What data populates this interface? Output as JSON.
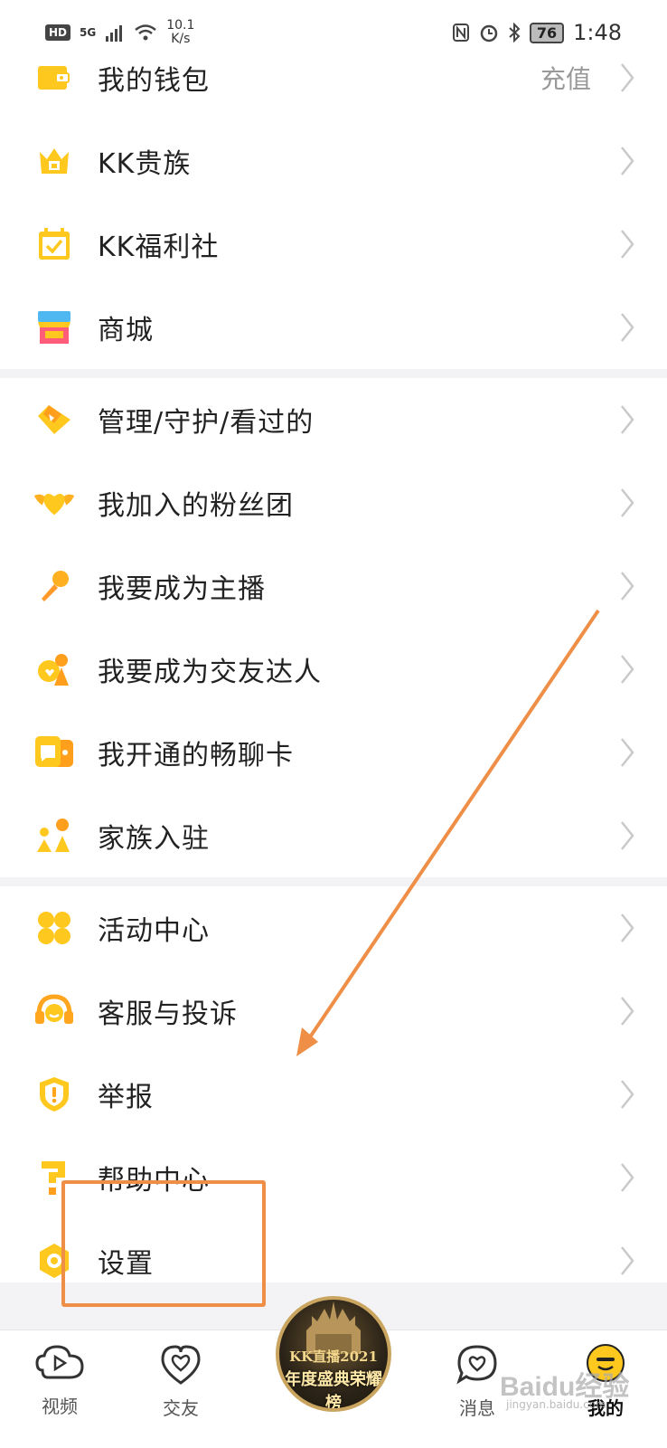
{
  "status_bar": {
    "left_badge": "HD",
    "signal": "5G",
    "net_speed_value": "10.1",
    "net_speed_unit": "K/s",
    "battery": "76",
    "time": "1:48"
  },
  "menu": {
    "group1": [
      {
        "label": "我的钱包",
        "aside": "充值",
        "icon": "wallet-icon"
      },
      {
        "label": "KK贵族",
        "icon": "crown-icon"
      },
      {
        "label": "KK福利社",
        "icon": "calendar-check-icon"
      },
      {
        "label": "商城",
        "icon": "shop-icon"
      }
    ],
    "group2": [
      {
        "label": "管理/守护/看过的",
        "icon": "diamond-icon"
      },
      {
        "label": "我加入的粉丝团",
        "icon": "winged-heart-icon"
      },
      {
        "label": "我要成为主播",
        "icon": "microphone-icon"
      },
      {
        "label": "我要成为交友达人",
        "icon": "dating-icon"
      },
      {
        "label": "我开通的畅聊卡",
        "icon": "chat-card-icon"
      },
      {
        "label": "家族入驻",
        "icon": "family-icon"
      }
    ],
    "group3": [
      {
        "label": "活动中心",
        "icon": "activity-icon"
      },
      {
        "label": "客服与投诉",
        "icon": "headset-icon"
      },
      {
        "label": "举报",
        "icon": "report-shield-icon"
      },
      {
        "label": "帮助中心",
        "icon": "question-icon"
      },
      {
        "label": "设置",
        "icon": "settings-icon"
      }
    ]
  },
  "bottom_nav": {
    "video": "视频",
    "friends": "交友",
    "badge_top": "KK直播2021",
    "badge_bottom": "年度盛典荣耀榜",
    "messages": "消息",
    "mine": "我的"
  },
  "watermark": {
    "main": "Baidu经验",
    "sub": "jingyan.baidu.com"
  },
  "colors": {
    "accent": "#ffc81e",
    "annotation": "#ef8f47",
    "divider": "#f3f3f5"
  }
}
